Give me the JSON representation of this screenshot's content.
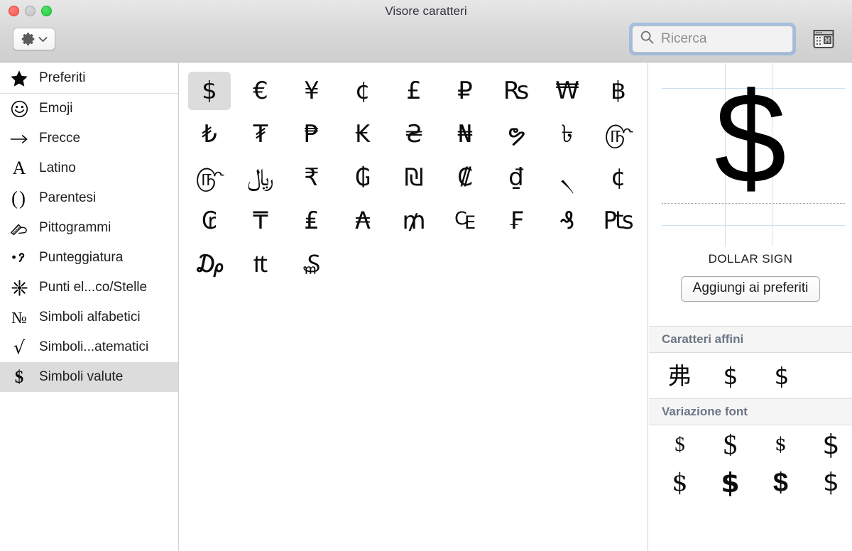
{
  "window": {
    "title": "Visore caratteri",
    "traffic_lights": [
      "close",
      "minimize",
      "maximize"
    ]
  },
  "toolbar": {
    "gear_button_label": "",
    "gear_icon": "gear-icon",
    "chevron_icon": "chevron-down-icon",
    "keyboard_toggle_icon": "character-palette-icon"
  },
  "search": {
    "placeholder": "Ricerca",
    "value": "",
    "icon": "search-icon",
    "focused": true,
    "focus_ring_color": "#76a8e4"
  },
  "sidebar": {
    "selected_index": 10,
    "items": [
      {
        "label": "Preferiti",
        "icon": "star-icon",
        "glyph": "★"
      },
      {
        "label": "Emoji",
        "icon": "smiley-face-icon",
        "glyph": "☺"
      },
      {
        "label": "Frecce",
        "icon": "arrow-right-icon",
        "glyph": "→"
      },
      {
        "label": "Latino",
        "icon": "letter-a-icon",
        "glyph": "A"
      },
      {
        "label": "Parentesi",
        "icon": "parentheses-icon",
        "glyph": "()"
      },
      {
        "label": "Pittogrammi",
        "icon": "writing-hand-icon",
        "glyph": "✍"
      },
      {
        "label": "Punteggiatura",
        "icon": "punctuation-icon",
        "glyph": "·,"
      },
      {
        "label": "Punti el...co/Stelle",
        "icon": "asterisk-star-icon",
        "glyph": "✳"
      },
      {
        "label": "Simboli alfabetici",
        "icon": "numero-sign-icon",
        "glyph": "№"
      },
      {
        "label": "Simboli...atematici",
        "icon": "square-root-icon",
        "glyph": "√"
      },
      {
        "label": "Simboli valute",
        "icon": "dollar-sign-icon",
        "glyph": "$"
      }
    ]
  },
  "grid": {
    "columns": 9,
    "selected_index": 0,
    "characters": [
      "$",
      "€",
      "¥",
      "¢",
      "£",
      "₽",
      "₨",
      "₩",
      "฿",
      "₺",
      "₮",
      "₱",
      "₭",
      "₴",
      "₦",
      "ຯ",
      "৳",
      "௹",
      "௹",
      "﷼",
      "₹",
      "₲",
      "₪",
      "₡",
      "₫",
      "৲",
      "¢",
      "₢",
      "₸",
      "₤",
      "₳",
      "₥",
      "₠",
      "₣",
      "₰",
      "₧",
      "₯",
      "₶",
      "₷"
    ]
  },
  "inspector": {
    "preview_glyph": "$",
    "character_name": "DOLLAR SIGN",
    "favorite_button_label": "Aggiungi ai preferiti",
    "related_section_title": "Caratteri affini",
    "related_characters": [
      "弗",
      "$",
      "$"
    ],
    "variants_section_title": "Variazione font",
    "variant_characters": [
      "$",
      "$",
      "$",
      "$",
      "$",
      "$",
      "$",
      "$"
    ],
    "guide_color": "#cfe0f5",
    "baseline_color": "#9a9a9a"
  }
}
